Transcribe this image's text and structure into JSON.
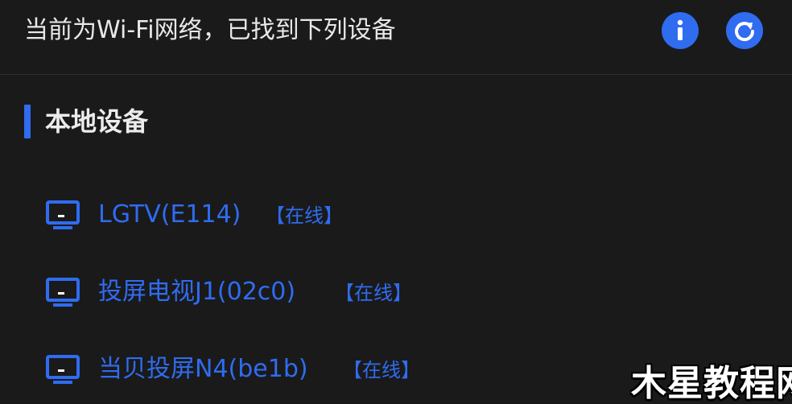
{
  "header": {
    "title": "当前为Wi-Fi网络，已找到下列设备",
    "info_icon": "info-icon",
    "refresh_icon": "refresh-icon"
  },
  "section": {
    "title": "本地设备"
  },
  "devices": [
    {
      "name": "LGTV(E114)",
      "status": "【在线】",
      "icon": "tv-icon"
    },
    {
      "name": "投屏电视J1(02c0)",
      "status": "【在线】",
      "icon": "tv-icon"
    },
    {
      "name": "当贝投屏N4(be1b)",
      "status": "【在线】",
      "icon": "tv-icon"
    }
  ],
  "watermark": "木星教程网",
  "colors": {
    "background": "#1a1a1b",
    "accent": "#2f6cf0",
    "text": "#e8e8e8"
  }
}
